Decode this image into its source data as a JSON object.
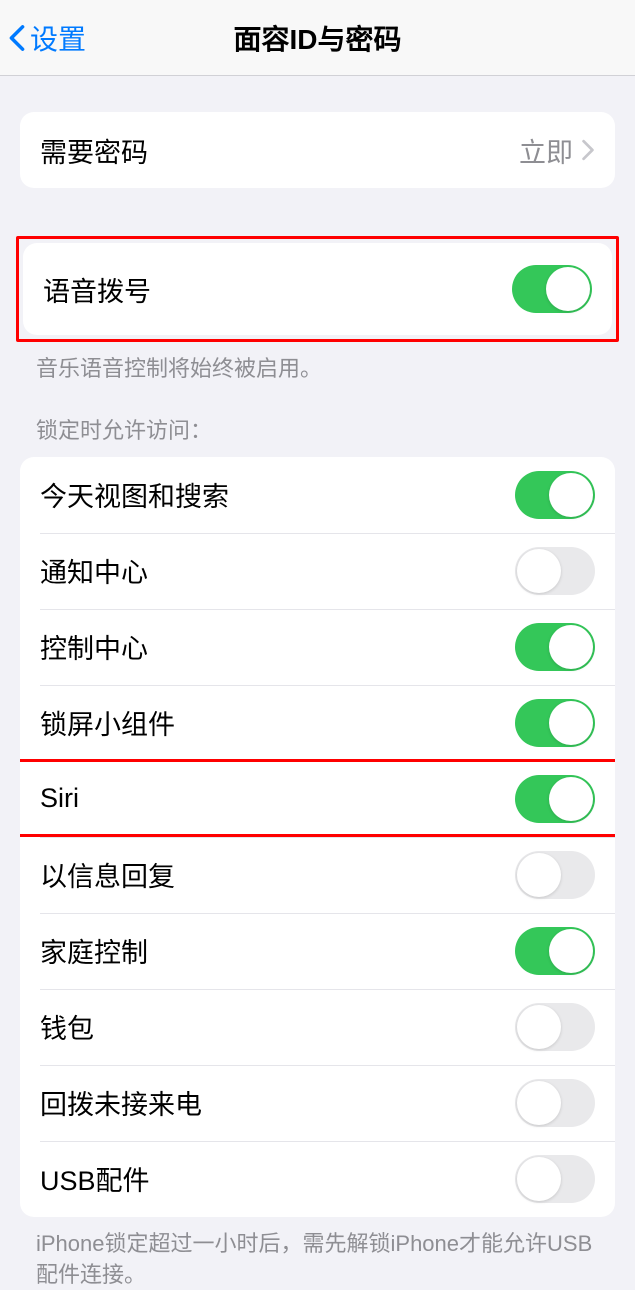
{
  "header": {
    "back_label": "设置",
    "title": "面容ID与密码"
  },
  "passcode_group": {
    "require_passcode": {
      "label": "需要密码",
      "value": "立即"
    }
  },
  "voice_group": {
    "voice_dial": {
      "label": "语音拨号",
      "on": true
    },
    "footer": "音乐语音控制将始终被启用。"
  },
  "locked_access": {
    "header": "锁定时允许访问：",
    "items": [
      {
        "label": "今天视图和搜索",
        "on": true
      },
      {
        "label": "通知中心",
        "on": false
      },
      {
        "label": "控制中心",
        "on": true
      },
      {
        "label": "锁屏小组件",
        "on": true
      },
      {
        "label": "Siri",
        "on": true
      },
      {
        "label": "以信息回复",
        "on": false
      },
      {
        "label": "家庭控制",
        "on": true
      },
      {
        "label": "钱包",
        "on": false
      },
      {
        "label": "回拨未接来电",
        "on": false
      },
      {
        "label": "USB配件",
        "on": false
      }
    ],
    "footer": "iPhone锁定超过一小时后，需先解锁iPhone才能允许USB配件连接。"
  }
}
